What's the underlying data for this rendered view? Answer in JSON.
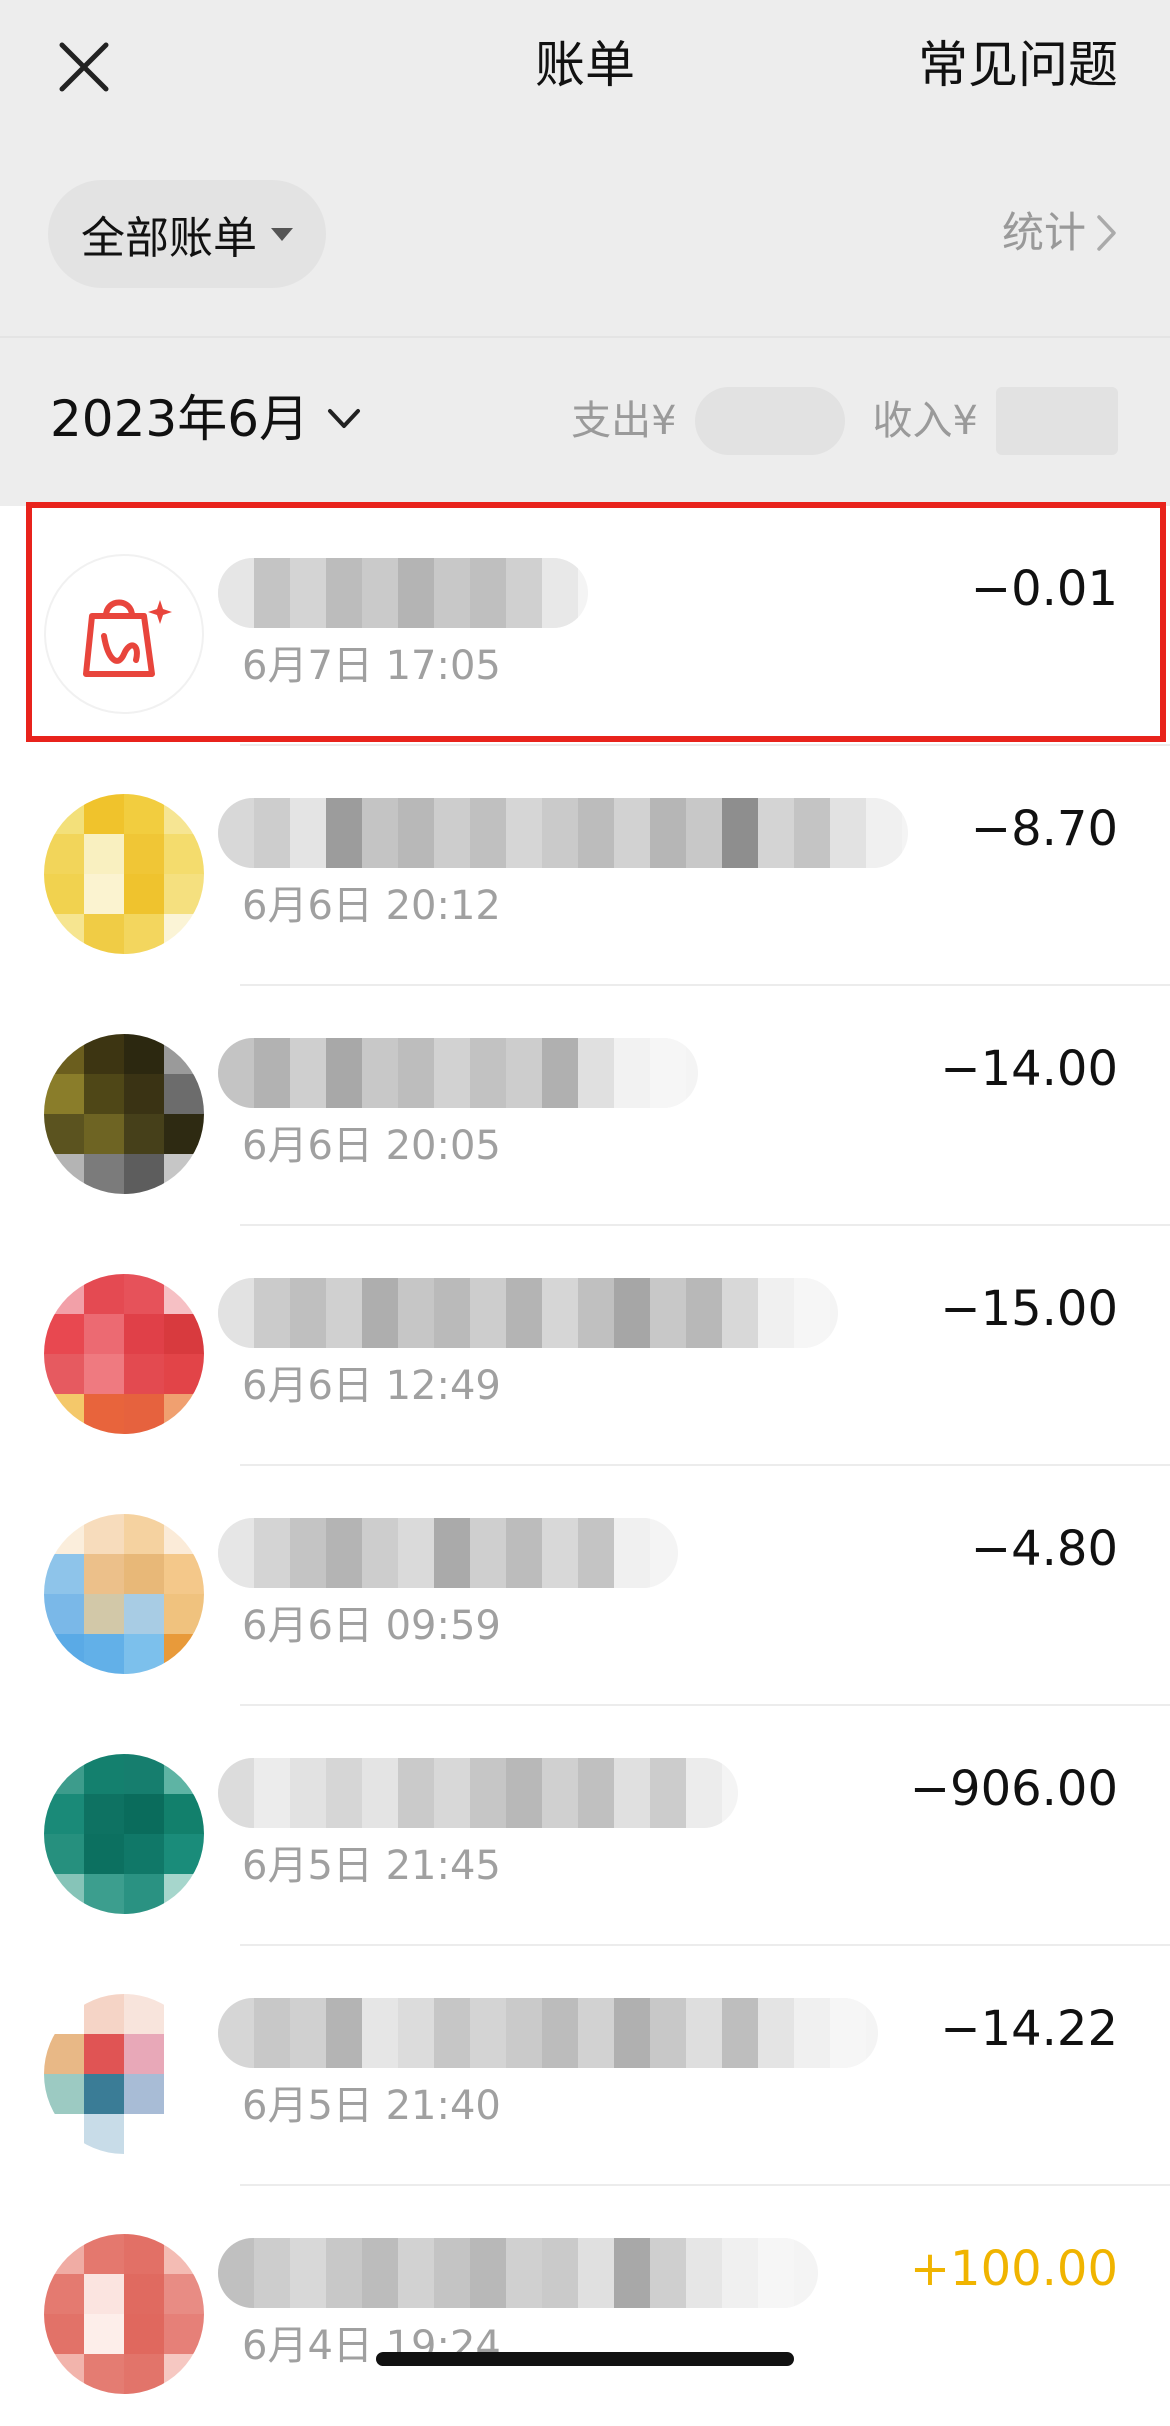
{
  "header": {
    "title": "账单",
    "faq_label": "常见问题"
  },
  "filter": {
    "selected": "全部账单",
    "stats_label": "统计"
  },
  "month_bar": {
    "month_label": "2023年6月",
    "expense_label": "支出¥",
    "income_label": "收入¥"
  },
  "transactions": [
    {
      "datetime": "6月7日 17:05",
      "amount": "−0.01",
      "kind": "expense",
      "icon": "shopping-bag-icon",
      "highlighted": true
    },
    {
      "datetime": "6月6日 20:12",
      "amount": "−8.70",
      "kind": "expense"
    },
    {
      "datetime": "6月6日 20:05",
      "amount": "−14.00",
      "kind": "expense"
    },
    {
      "datetime": "6月6日 12:49",
      "amount": "−15.00",
      "kind": "expense"
    },
    {
      "datetime": "6月6日 09:59",
      "amount": "−4.80",
      "kind": "expense"
    },
    {
      "datetime": "6月5日 21:45",
      "amount": "−906.00",
      "kind": "expense"
    },
    {
      "datetime": "6月5日 21:40",
      "amount": "−14.22",
      "kind": "expense"
    },
    {
      "datetime": "6月4日 19:24",
      "amount": "+100.00",
      "kind": "income"
    }
  ],
  "colors": {
    "highlight_border": "#e8231c",
    "income_amount": "#f0b400",
    "brand_icon": "#e8453c"
  }
}
